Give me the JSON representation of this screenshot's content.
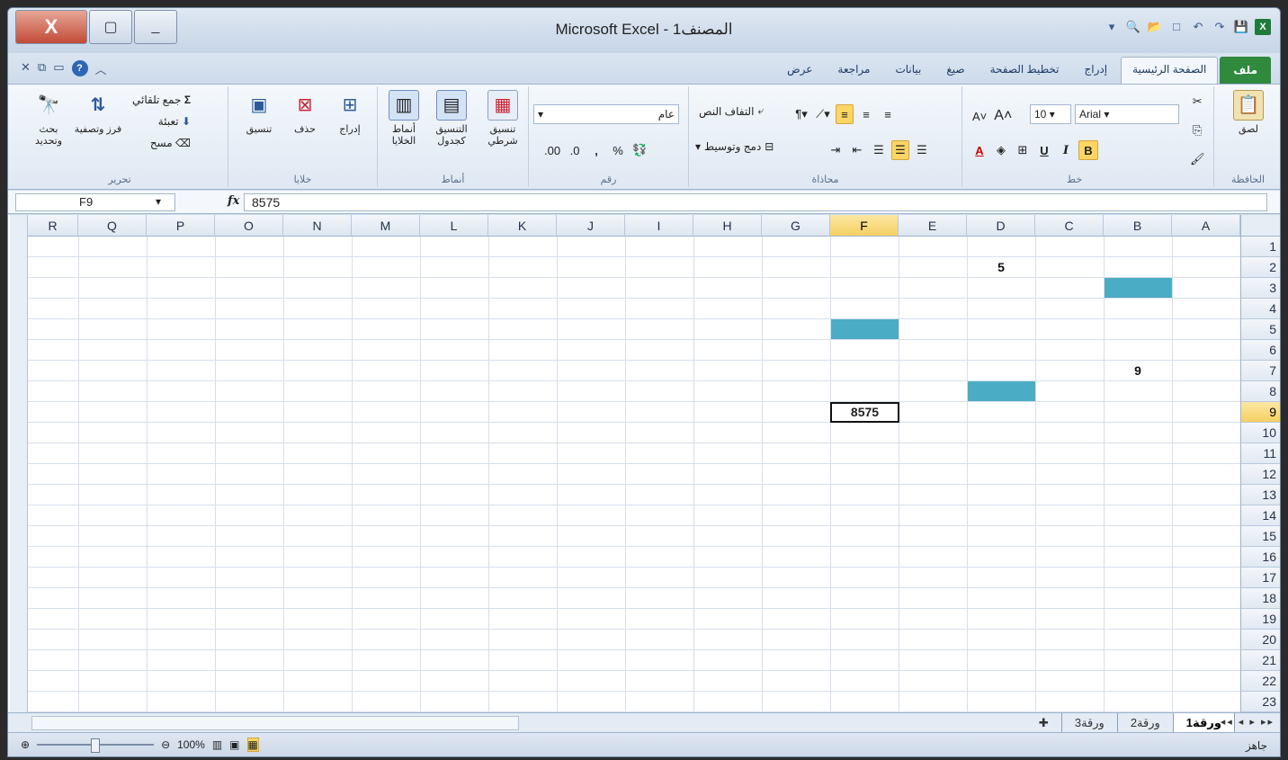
{
  "window": {
    "title": "Microsoft Excel - المصنف1",
    "close_glyph": "X",
    "restore_glyph": "▢",
    "minimize_glyph": "_"
  },
  "tabs": [
    "ملف",
    "الصفحة الرئيسية",
    "إدراج",
    "تخطيط الصفحة",
    "صيغ",
    "بيانات",
    "مراجعة",
    "عرض"
  ],
  "ribbon": {
    "clipboard": {
      "label": "الحافظة",
      "paste": "لصق"
    },
    "font": {
      "label": "خط",
      "name": "Arial",
      "size": "10",
      "bold": "B",
      "italic": "I",
      "underline": "U"
    },
    "alignment": {
      "label": "محاذاة",
      "wrap": "التفاف النص",
      "merge": "دمج وتوسيط"
    },
    "number": {
      "label": "رقم",
      "format": "عام",
      "percent": "%",
      "comma": ",",
      "inc_dec": ".00",
      "dec_dec": ".0"
    },
    "styles": {
      "label": "أنماط",
      "conditional": "تنسيق شرطي",
      "as_table": "التنسيق كجدول",
      "cell_styles": "أنماط الخلايا"
    },
    "cells": {
      "label": "خلايا",
      "insert": "إدراج",
      "delete": "حذف",
      "format": "تنسيق"
    },
    "editing": {
      "label": "تحرير",
      "autosum": "جمع تلقائي",
      "fill": "تعبئة",
      "clear": "مسح",
      "sort": "فرز وتصفية",
      "find": "بحث وتحديد"
    }
  },
  "formula_bar": {
    "name_box": "F9",
    "fx": "fx",
    "content": "8575"
  },
  "columns": [
    "A",
    "B",
    "C",
    "D",
    "E",
    "F",
    "G",
    "H",
    "I",
    "J",
    "K",
    "L",
    "M",
    "N",
    "O",
    "P",
    "Q",
    "R"
  ],
  "rows": [
    "1",
    "2",
    "3",
    "4",
    "5",
    "6",
    "7",
    "8",
    "9",
    "10",
    "11",
    "12",
    "13",
    "14",
    "15",
    "16",
    "17",
    "18",
    "19",
    "20",
    "21",
    "22",
    "23"
  ],
  "cells": {
    "D2": "5",
    "B7": "9",
    "F9": "8575"
  },
  "fills": {
    "color": "#4bacc6",
    "cells": [
      "B3",
      "F5",
      "D8"
    ]
  },
  "sheet_tabs": [
    "ورقة1",
    "ورقة2",
    "ورقة3"
  ],
  "active_sheet": "ورقة1",
  "status": {
    "ready": "جاهز",
    "zoom": "100%"
  }
}
